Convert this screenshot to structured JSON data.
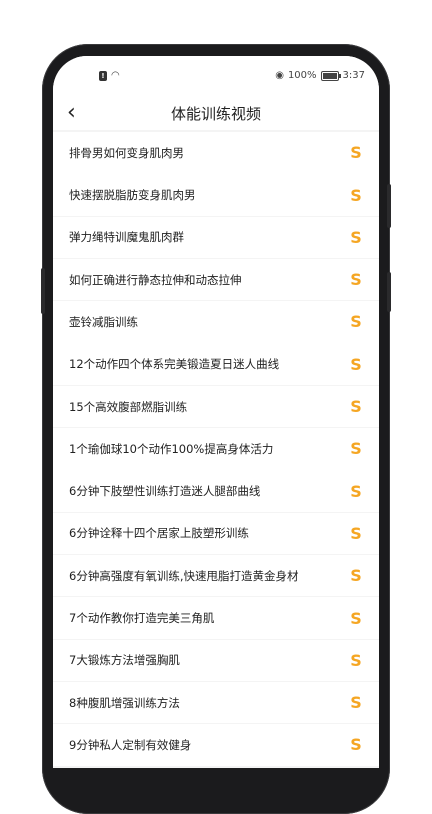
{
  "status_bar": {
    "battery": "100%",
    "time": "3:37"
  },
  "header": {
    "title": "体能训练视频"
  },
  "icons": {
    "back": "chevron-left-icon",
    "item_marker": "s-icon"
  },
  "colors": {
    "accent": "#f5a623"
  },
  "items": [
    {
      "label": "排骨男如何变身肌肉男"
    },
    {
      "label": "快速摆脱脂肪变身肌肉男"
    },
    {
      "label": "弹力绳特训魔鬼肌肉群"
    },
    {
      "label": "如何正确进行静态拉伸和动态拉伸"
    },
    {
      "label": "壶铃减脂训练"
    },
    {
      "label": "12个动作四个体系完美锻造夏日迷人曲线"
    },
    {
      "label": "15个高效腹部燃脂训练"
    },
    {
      "label": "1个瑜伽球10个动作100%提高身体活力"
    },
    {
      "label": "6分钟下肢塑性训练打造迷人腿部曲线"
    },
    {
      "label": "6分钟诠释十四个居家上肢塑形训练"
    },
    {
      "label": "6分钟高强度有氧训练,快速甩脂打造黄金身材"
    },
    {
      "label": "7个动作教你打造完美三角肌"
    },
    {
      "label": "7大锻炼方法增强胸肌"
    },
    {
      "label": "8种腹肌增强训练方法"
    },
    {
      "label": "9分钟私人定制有效健身"
    }
  ]
}
